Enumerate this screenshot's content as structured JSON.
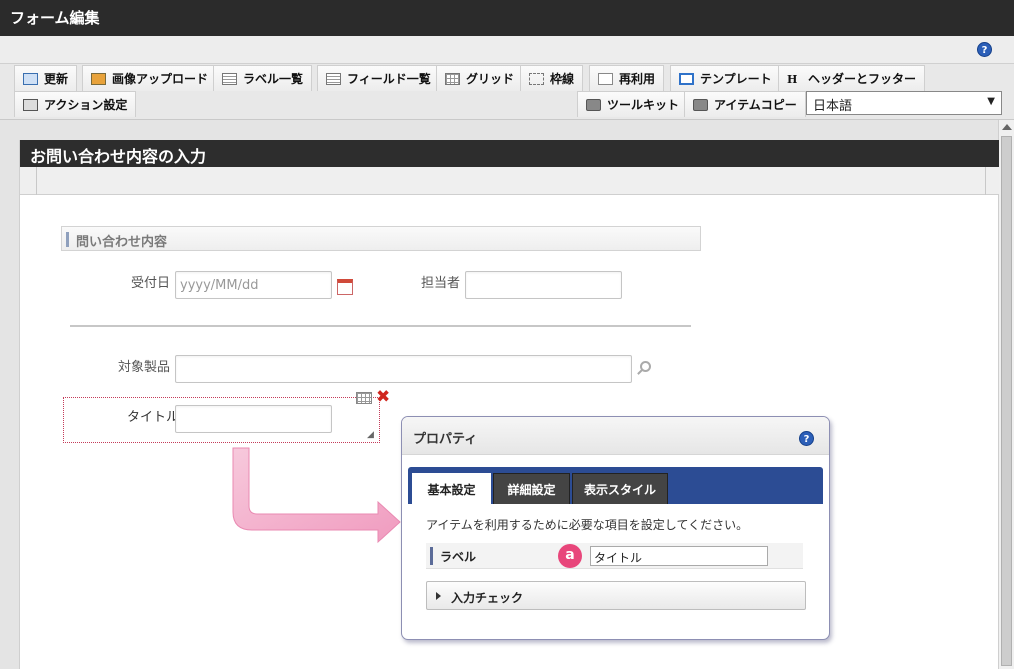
{
  "window": {
    "title": "フォーム編集"
  },
  "toolbar": {
    "row1": [
      {
        "label": "更新",
        "icon": "update-icon"
      },
      {
        "label": "画像アップロード",
        "icon": "image-upload-icon"
      },
      {
        "label": "ラベル一覧",
        "icon": "label-list-icon"
      },
      {
        "label": "フィールド一覧",
        "icon": "field-list-icon"
      },
      {
        "label": "グリッド",
        "icon": "grid-icon"
      },
      {
        "label": "枠線",
        "icon": "border-icon"
      },
      {
        "label": "再利用",
        "icon": "reuse-icon"
      },
      {
        "label": "テンプレート",
        "icon": "template-icon"
      },
      {
        "label": "ヘッダーとフッター",
        "icon": "header-footer-icon"
      }
    ],
    "action_label": "アクション設定",
    "toolkit_label": "ツールキット",
    "item_copy_label": "アイテムコピー",
    "language": "日本語"
  },
  "form": {
    "title": "お問い合わせ内容の入力",
    "section_title": "問い合わせ内容",
    "fields": {
      "received_date_label": "受付日",
      "received_date_placeholder": "yyyy/MM/dd",
      "assignee_label": "担当者",
      "product_label": "対象製品",
      "title_label": "タイトル"
    }
  },
  "property_panel": {
    "title": "プロパティ",
    "tabs": [
      "基本設定",
      "詳細設定",
      "表示スタイル"
    ],
    "active_tab": "基本設定",
    "description": "アイテムを利用するために必要な項目を設定してください。",
    "label_row": {
      "label": "ラベル",
      "badge": "a",
      "value": "タイトル"
    },
    "input_check_label": "入力チェック"
  },
  "colors": {
    "title_bar": "#2b2b2b",
    "tab_bar": "#2c4c94",
    "badge": "#e8467b",
    "arrow": "#f2a9c8",
    "selection_border": "#c43b5a"
  }
}
